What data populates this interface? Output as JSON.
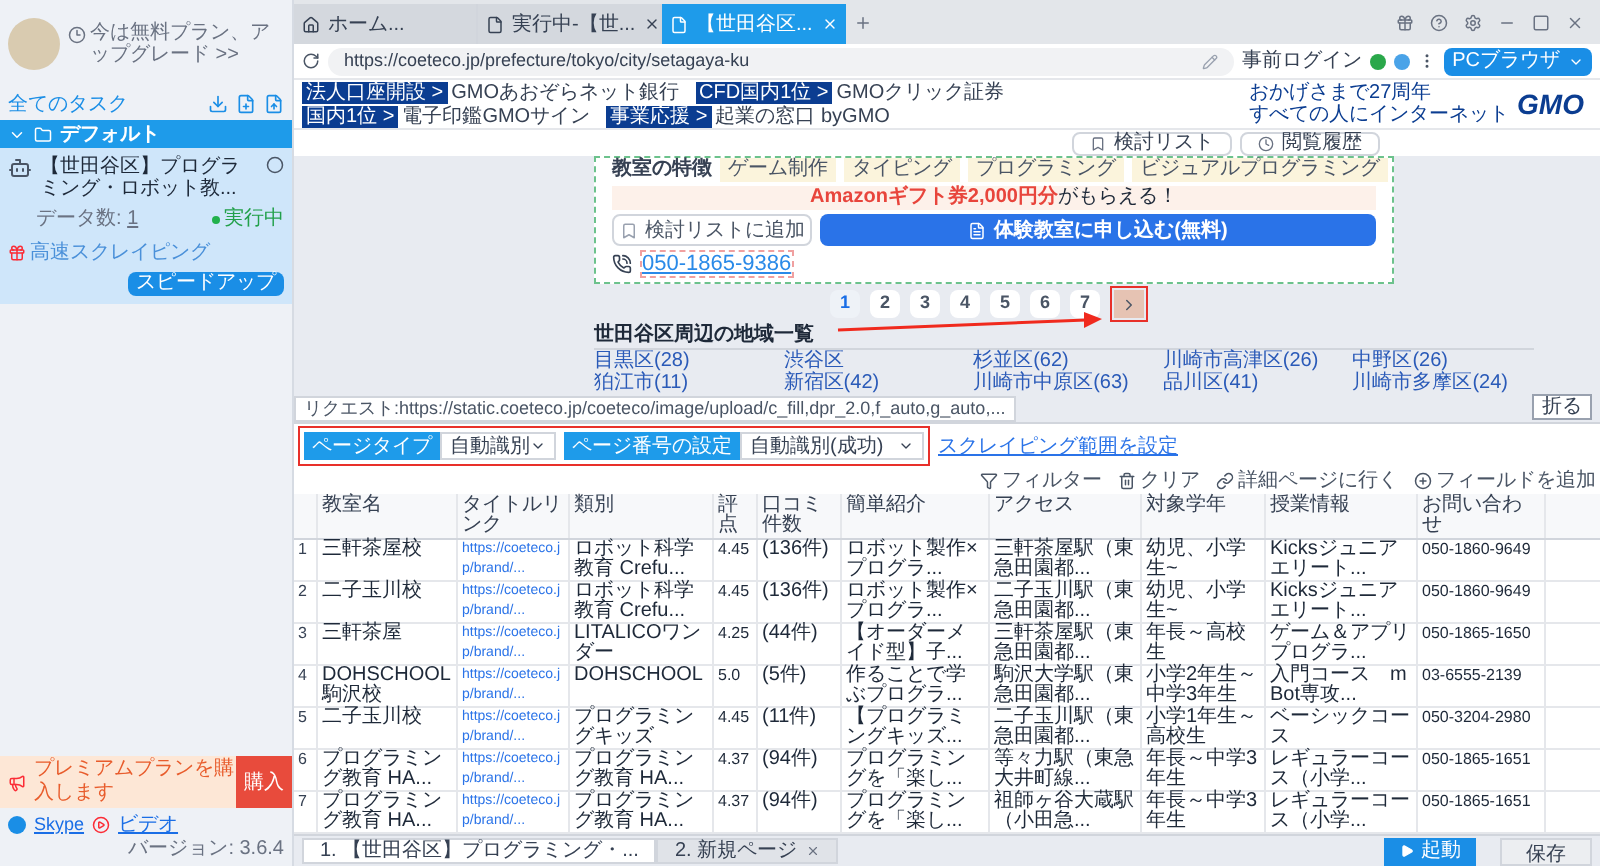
{
  "sidebar": {
    "plan_text": "今は無料プラン、アップグレード >>",
    "all_tasks_label": "全てのタスク",
    "group": {
      "name": "デフォルト",
      "expanded": true
    },
    "tasks": [
      {
        "title": "【世田谷区】プログラミング・ロボット教...",
        "data_count_label": "データ数:",
        "data_count": "1",
        "status": "実行中",
        "mode": "高速スクレイピング",
        "action": "スピードアップ",
        "selected": true
      }
    ],
    "premium": {
      "text": "プレミアムプランを購入します",
      "button": "購入"
    },
    "links": [
      "Skype",
      "ビデオ"
    ],
    "version": "バージョン: 3.6.4"
  },
  "browser": {
    "tabs": [
      {
        "label": "ホーム...",
        "kind": "home",
        "selected": false
      },
      {
        "label": "実行中-【世...",
        "kind": "page",
        "selected": false
      },
      {
        "label": "【世田谷区...",
        "kind": "page",
        "selected": true
      }
    ],
    "address": "https://coeteco.jp/prefecture/tokyo/city/setagaya-ku",
    "login": "事前ログイン",
    "browser_button": "PCブラウザ",
    "bookmarks": [
      {
        "badge": "法人口座開設 >",
        "label": "GMOあおぞらネット銀行"
      },
      {
        "badge": "CFD国内1位 >",
        "label": "GMOクリック証券"
      },
      {
        "badge": "国内1位 >",
        "label": "電子印鑑GMOサイン"
      },
      {
        "badge": "事業応援 >",
        "label": "起業の窓口 byGMO"
      }
    ],
    "gmo": {
      "tagline_1": "おかげさまで27周年",
      "tagline_2": "すべての人にインターネット",
      "logo": "GMO"
    }
  },
  "page": {
    "header_buttons": [
      {
        "kind": "bookmark",
        "label": "検討リスト"
      },
      {
        "kind": "history",
        "label": "閲覧履歴"
      }
    ],
    "feature_label": "教室の特徴",
    "features": [
      "ゲーム制作",
      "タイピング",
      "プログラミング",
      "ビジュアルプログラミング"
    ],
    "promo": "**Amazonギフト券2,000円分**がもらえる！",
    "save_button": "検討リストに追加",
    "apply_button": "体験教室に申し込む(無料)",
    "phone": "050-1865-9386",
    "pagination": [
      {
        "label": "1",
        "selected": true
      },
      {
        "label": "2",
        "selected": false
      },
      {
        "label": "3",
        "selected": false
      },
      {
        "label": "4",
        "selected": false
      },
      {
        "label": "5",
        "selected": false
      },
      {
        "label": "6",
        "selected": false
      },
      {
        "label": "7",
        "selected": false
      }
    ],
    "areas_title": "世田谷区周辺の地域一覧",
    "areas": [
      "目黒区(28)",
      "渋谷区",
      "杉並区(62)",
      "川崎市高津区(26)",
      "中野区(26)",
      "狛江市(11)",
      "新宿区(42)",
      "川崎市中原区(63)",
      "品川区(41)",
      "川崎市多摩区(24)"
    ]
  },
  "request": "リクエスト:https://static.coeteco.jp/coeteco/image/upload/c_fill,dpr_2.0,f_auto,g_auto,...",
  "collapse_button": "折る",
  "toolbar": {
    "page_type": {
      "label": "ページタイプ",
      "value": "自動識別"
    },
    "page_number": {
      "label": "ページ番号の設定",
      "value": "自動識別(成功)"
    },
    "range_link": "スクレイピング範囲を設定",
    "actions": [
      {
        "kind": "filter",
        "label": "フィルター"
      },
      {
        "kind": "clear",
        "label": "クリア"
      },
      {
        "kind": "detail",
        "label": "詳細ページに行く"
      },
      {
        "kind": "add",
        "label": "フィールドを追加"
      }
    ]
  },
  "table": {
    "columns": [
      "",
      "教室名",
      "タイトルリンク",
      "類別",
      "評点",
      "口コミ件数",
      "簡単紹介",
      "アクセス",
      "対象学年",
      "授業情報",
      "お問い合わせ"
    ],
    "rows": [
      [
        "1",
        "三軒茶屋校",
        "https://coeteco.jp/brand/...",
        "ロボット科学教育 Crefu...",
        "4.45",
        "(136件)",
        "ロボット製作×プログラ...",
        "三軒茶屋駅（東急田園都...",
        "幼児、小学生~",
        "Kicksジュニアエリート...",
        "050-1860-9649"
      ],
      [
        "2",
        "二子玉川校",
        "https://coeteco.jp/brand/...",
        "ロボット科学教育 Crefu...",
        "4.45",
        "(136件)",
        "ロボット製作×プログラ...",
        "二子玉川駅（東急田園都...",
        "幼児、小学生~",
        "Kicksジュニアエリート...",
        "050-1860-9649"
      ],
      [
        "3",
        "三軒茶屋",
        "https://coeteco.jp/brand/...",
        "LITALICOワンダー",
        "4.25",
        "(44件)",
        "【オーダーメイド型】子...",
        "三軒茶屋駅（東急田園都...",
        "年長～高校生",
        "ゲーム＆アプリプログラ...",
        "050-1865-1650"
      ],
      [
        "4",
        "DOHSCHOOL 駒沢校",
        "https://coeteco.jp/brand/...",
        "DOHSCHOOL",
        "5.0",
        "(5件)",
        "作ることで学ぶプログラ...",
        "駒沢大学駅（東急田園都...",
        "小学2年生～中学3年生",
        "入門コース　mBot専攻...",
        "03-6555-2139"
      ],
      [
        "5",
        "二子玉川校",
        "https://coeteco.jp/brand/...",
        "プログラミングキッズ",
        "4.45",
        "(11件)",
        "【プログラミングキッズ...",
        "二子玉川駅（東急田園都...",
        "小学1年生～高校生",
        "ベーシックコース",
        "050-3204-2980"
      ],
      [
        "6",
        "プログラミング教育 HA...",
        "https://coeteco.jp/brand/...",
        "プログラミング教育 HA...",
        "4.37",
        "(94件)",
        "プログラミングを「楽し...",
        "等々力駅（東急大井町線...",
        "年長～中学3年生",
        "レギュラーコース（小学...",
        "050-1865-1651"
      ],
      [
        "7",
        "プログラミング教育 HA...",
        "https://coeteco.jp/brand/...",
        "プログラミング教育 HA...",
        "4.37",
        "(94件)",
        "プログラミングを「楽し...",
        "祖師ヶ谷大蔵駅（小田急...",
        "年長～中学3年生",
        "レギュラーコース（小学...",
        "050-1865-1651"
      ]
    ]
  },
  "run_tabs": [
    {
      "label": "1. 【世田谷区】プログラミング・...",
      "selected": true
    },
    {
      "label": "2. 新規ページ",
      "selected": false
    }
  ],
  "buttons": {
    "start": "起動",
    "save": "保存"
  }
}
